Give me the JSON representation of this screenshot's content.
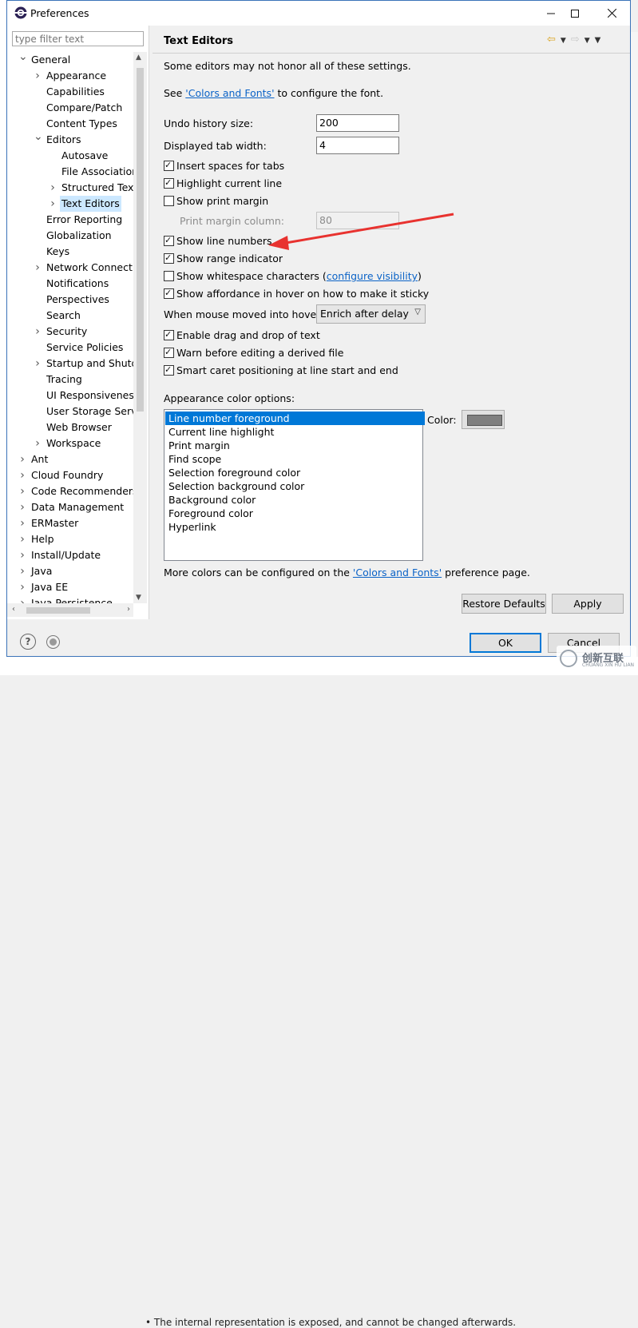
{
  "window": {
    "title": "Preferences"
  },
  "filter": {
    "placeholder": "type filter text"
  },
  "tree": {
    "items": [
      {
        "label": "General",
        "depth": 0,
        "chevron": "expanded"
      },
      {
        "label": "Appearance",
        "depth": 1,
        "chevron": "collapsed"
      },
      {
        "label": "Capabilities",
        "depth": 1,
        "chevron": "none"
      },
      {
        "label": "Compare/Patch",
        "depth": 1,
        "chevron": "none"
      },
      {
        "label": "Content Types",
        "depth": 1,
        "chevron": "none"
      },
      {
        "label": "Editors",
        "depth": 1,
        "chevron": "expanded"
      },
      {
        "label": "Autosave",
        "depth": 2,
        "chevron": "none"
      },
      {
        "label": "File Associations",
        "depth": 2,
        "chevron": "none"
      },
      {
        "label": "Structured Text",
        "depth": 2,
        "chevron": "collapsed"
      },
      {
        "label": "Text Editors",
        "depth": 2,
        "chevron": "collapsed",
        "selected": true
      },
      {
        "label": "Error Reporting",
        "depth": 1,
        "chevron": "none"
      },
      {
        "label": "Globalization",
        "depth": 1,
        "chevron": "none"
      },
      {
        "label": "Keys",
        "depth": 1,
        "chevron": "none"
      },
      {
        "label": "Network Connections",
        "depth": 1,
        "chevron": "collapsed"
      },
      {
        "label": "Notifications",
        "depth": 1,
        "chevron": "none"
      },
      {
        "label": "Perspectives",
        "depth": 1,
        "chevron": "none"
      },
      {
        "label": "Search",
        "depth": 1,
        "chevron": "none"
      },
      {
        "label": "Security",
        "depth": 1,
        "chevron": "collapsed"
      },
      {
        "label": "Service Policies",
        "depth": 1,
        "chevron": "none"
      },
      {
        "label": "Startup and Shutdown",
        "depth": 1,
        "chevron": "collapsed"
      },
      {
        "label": "Tracing",
        "depth": 1,
        "chevron": "none"
      },
      {
        "label": "UI Responsiveness",
        "depth": 1,
        "chevron": "none"
      },
      {
        "label": "User Storage Service",
        "depth": 1,
        "chevron": "none"
      },
      {
        "label": "Web Browser",
        "depth": 1,
        "chevron": "none"
      },
      {
        "label": "Workspace",
        "depth": 1,
        "chevron": "collapsed"
      },
      {
        "label": "Ant",
        "depth": 0,
        "chevron": "collapsed"
      },
      {
        "label": "Cloud Foundry",
        "depth": 0,
        "chevron": "collapsed"
      },
      {
        "label": "Code Recommenders",
        "depth": 0,
        "chevron": "collapsed"
      },
      {
        "label": "Data Management",
        "depth": 0,
        "chevron": "collapsed"
      },
      {
        "label": "ERMaster",
        "depth": 0,
        "chevron": "collapsed"
      },
      {
        "label": "Help",
        "depth": 0,
        "chevron": "collapsed"
      },
      {
        "label": "Install/Update",
        "depth": 0,
        "chevron": "collapsed"
      },
      {
        "label": "Java",
        "depth": 0,
        "chevron": "collapsed"
      },
      {
        "label": "Java EE",
        "depth": 0,
        "chevron": "collapsed"
      },
      {
        "label": "Java Persistence",
        "depth": 0,
        "chevron": "collapsed"
      }
    ]
  },
  "page": {
    "title": "Text Editors",
    "note": "Some editors may not honor all of these settings.",
    "see_prefix": "See ",
    "colors_fonts_link": "'Colors and Fonts'",
    "see_suffix": " to configure the font.",
    "undo_label": "Undo history size:",
    "undo_value": "200",
    "tab_width_label": "Displayed tab width:",
    "tab_width_value": "4",
    "print_margin_column_label": "Print margin column:",
    "print_margin_column_value": "80",
    "checkboxes": {
      "insert_spaces": {
        "label": "Insert spaces for tabs",
        "checked": true
      },
      "highlight_line": {
        "label": "Highlight current line",
        "checked": true
      },
      "show_print_margin": {
        "label": "Show print margin",
        "checked": false
      },
      "show_line_numbers": {
        "label": "Show line numbers",
        "checked": true
      },
      "show_range_indicator": {
        "label": "Show range indicator",
        "checked": true
      },
      "show_whitespace": {
        "label": "Show whitespace characters (",
        "checked": false
      },
      "show_affordance": {
        "label": "Show affordance in hover on how to make it sticky",
        "checked": true
      },
      "drag_drop": {
        "label": "Enable drag and drop of text",
        "checked": true
      },
      "warn_derived": {
        "label": "Warn before editing a derived file",
        "checked": true
      },
      "smart_caret": {
        "label": "Smart caret positioning at line start and end",
        "checked": true
      }
    },
    "configure_visibility_link": "configure visibility",
    "close_paren": ")",
    "hover_label": "When mouse moved into hover:",
    "hover_value": "Enrich after delay",
    "appearance_label": "Appearance color options:",
    "color_options": [
      "Line number foreground",
      "Current line highlight",
      "Print margin",
      "Find scope",
      "Selection foreground color",
      "Selection background color",
      "Background color",
      "Foreground color",
      "Hyperlink"
    ],
    "selected_color_option": "Line number foreground",
    "color_label": "Color:",
    "color_value": "#808080",
    "more_colors_prefix": "More colors can be configured on the ",
    "more_colors_link": "'Colors and Fonts'",
    "more_colors_suffix": " preference page.",
    "restore_defaults": "Restore Defaults",
    "apply": "Apply"
  },
  "footer": {
    "ok": "OK",
    "cancel": "Cancel"
  },
  "background": {
    "bottom_text": "• The internal representation is exposed, and cannot be changed afterwards."
  },
  "watermark": {
    "text": "创新互联",
    "sub": "CHUANG XIN HU LIAN"
  }
}
